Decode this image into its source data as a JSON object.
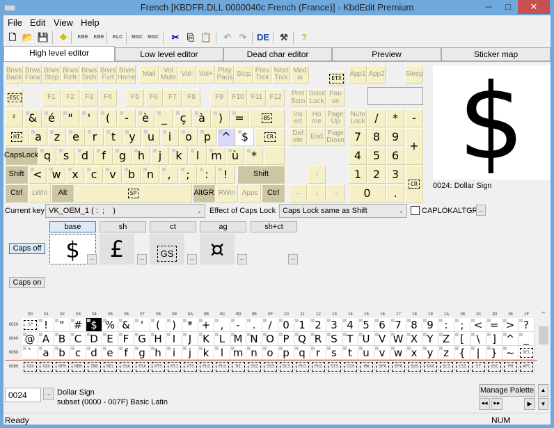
{
  "window": {
    "title": "French [KBDFR.DLL 0000040c French (France)] - KbdEdit Premium",
    "minimize": "─",
    "maximize": "□",
    "close": "✕"
  },
  "menu": [
    {
      "label": "File"
    },
    {
      "label": "Edit"
    },
    {
      "label": "View"
    },
    {
      "label": "Help"
    }
  ],
  "toolbar": [
    {
      "icon": "new-file-icon",
      "glyph": "🗋"
    },
    {
      "icon": "open-folder-icon",
      "glyph": "📂"
    },
    {
      "icon": "save-icon",
      "glyph": "💾"
    },
    {
      "icon": "package-icon",
      "glyph": "❖"
    },
    {
      "icon": "kbe-open-icon",
      "glyph": "KBE"
    },
    {
      "icon": "kbe-save-icon",
      "glyph": "KBE"
    },
    {
      "icon": "klc-open-icon",
      "glyph": "KLC"
    },
    {
      "icon": "mac-open-icon",
      "glyph": "MAC"
    },
    {
      "icon": "mac-save-icon",
      "glyph": "MAC"
    },
    {
      "icon": "cut-icon",
      "glyph": "✂"
    },
    {
      "icon": "copy-icon",
      "glyph": "⎘"
    },
    {
      "icon": "paste-icon",
      "glyph": "📋"
    },
    {
      "icon": "undo-icon",
      "glyph": "↶"
    },
    {
      "icon": "redo-icon",
      "glyph": "↷"
    },
    {
      "icon": "language-icon",
      "glyph": "DE"
    },
    {
      "icon": "tools-icon",
      "glyph": "⚒"
    },
    {
      "icon": "help-icon",
      "glyph": "?"
    }
  ],
  "tabs": [
    {
      "label": "High level editor",
      "active": true
    },
    {
      "label": "Low level editor"
    },
    {
      "label": "Dead char editor"
    },
    {
      "label": "Preview"
    },
    {
      "label": "Sticker map"
    }
  ],
  "keyboard": {
    "keys": [
      {
        "label": "Brws\nBack",
        "s": "dis"
      },
      {
        "label": "Brws\nForw",
        "s": "dis"
      },
      {
        "label": "Brws\nStop",
        "s": "dis"
      },
      {
        "label": "Brws\nRefr",
        "s": "dis"
      },
      {
        "label": "Brws\nSrch",
        "s": "dis"
      },
      {
        "label": "Brws\nFvrt",
        "s": "dis"
      },
      {
        "label": "Brws\nHome",
        "s": "dis"
      },
      {
        "label": "Mail",
        "s": "dis"
      },
      {
        "label": "Vol\nMute",
        "s": "dis"
      },
      {
        "label": "Vol-",
        "s": "dis"
      },
      {
        "label": "Vol+",
        "s": "dis"
      },
      {
        "label": "Play\nPaus",
        "s": "dis"
      },
      {
        "label": "Stop",
        "s": "dis"
      },
      {
        "label": "Prev\nTrck",
        "s": "dis"
      },
      {
        "label": "Next\nTrck",
        "s": "dis"
      },
      {
        "label": "Med\nia",
        "s": "dis"
      },
      {
        "label": "ETX",
        "s": "ctl"
      },
      {
        "label": "App1",
        "s": "dis"
      },
      {
        "label": "App2",
        "s": "dis"
      },
      {
        "label": "Sleep",
        "s": "dis"
      },
      {
        "label": "ESC",
        "s": "ctl"
      },
      {
        "label": "F1",
        "s": "dis"
      },
      {
        "label": "F2",
        "s": "dis"
      },
      {
        "label": "F3",
        "s": "dis"
      },
      {
        "label": "F4",
        "s": "dis"
      },
      {
        "label": "F5",
        "s": "dis"
      },
      {
        "label": "F6",
        "s": "dis"
      },
      {
        "label": "F7",
        "s": "dis"
      },
      {
        "label": "F8",
        "s": "dis"
      },
      {
        "label": "F9",
        "s": "dis"
      },
      {
        "label": "F10",
        "s": "dis"
      },
      {
        "label": "F11",
        "s": "dis"
      },
      {
        "label": "F12",
        "s": "dis"
      },
      {
        "label": "Prnt\nScrn",
        "s": "dis"
      },
      {
        "label": "Scrol\nLock",
        "s": "dis"
      },
      {
        "label": "Pau\nse",
        "s": "dis"
      },
      {
        "label": "²",
        "s": "small"
      },
      {
        "label": "&"
      },
      {
        "label": "é"
      },
      {
        "label": "\""
      },
      {
        "label": "'"
      },
      {
        "label": "("
      },
      {
        "label": "-"
      },
      {
        "label": "è"
      },
      {
        "label": "_"
      },
      {
        "label": "ç"
      },
      {
        "label": "à"
      },
      {
        "label": ")"
      },
      {
        "label": "="
      },
      {
        "label": "BS",
        "s": "ctl"
      },
      {
        "label": "Ins\nert",
        "s": "dis"
      },
      {
        "label": "Ho\nme",
        "s": "dis"
      },
      {
        "label": "Page\nUp",
        "s": "dis"
      },
      {
        "label": "Num\nLock",
        "s": "dis"
      },
      {
        "label": "/"
      },
      {
        "label": "*"
      },
      {
        "label": "-"
      },
      {
        "label": "HT",
        "s": "ctl"
      },
      {
        "label": "a"
      },
      {
        "label": "z"
      },
      {
        "label": "e"
      },
      {
        "label": "r"
      },
      {
        "label": "t"
      },
      {
        "label": "y"
      },
      {
        "label": "u"
      },
      {
        "label": "i"
      },
      {
        "label": "o"
      },
      {
        "label": "p"
      },
      {
        "label": "^",
        "s": "hl"
      },
      {
        "label": "$",
        "s": "sel"
      },
      {
        "label": "CR",
        "s": "ctl"
      },
      {
        "label": "Del\nete",
        "s": "dis"
      },
      {
        "label": "End",
        "s": "dis"
      },
      {
        "label": "Page\nDown",
        "s": "dis"
      },
      {
        "label": "7"
      },
      {
        "label": "8"
      },
      {
        "label": "9"
      },
      {
        "label": "+"
      },
      {
        "label": "CapsLock",
        "s": "mod"
      },
      {
        "label": "q"
      },
      {
        "label": "s"
      },
      {
        "label": "d"
      },
      {
        "label": "f"
      },
      {
        "label": "g"
      },
      {
        "label": "h"
      },
      {
        "label": "j"
      },
      {
        "label": "k"
      },
      {
        "label": "l"
      },
      {
        "label": "m"
      },
      {
        "label": "ù"
      },
      {
        "label": "*"
      },
      {
        "label": ""
      },
      {
        "label": "4"
      },
      {
        "label": "5"
      },
      {
        "label": "6"
      },
      {
        "label": "Shift",
        "s": "mod"
      },
      {
        "label": "<"
      },
      {
        "label": "w"
      },
      {
        "label": "x"
      },
      {
        "label": "c"
      },
      {
        "label": "v"
      },
      {
        "label": "b"
      },
      {
        "label": "n"
      },
      {
        "label": ","
      },
      {
        "label": ";"
      },
      {
        "label": ":"
      },
      {
        "label": "!"
      },
      {
        "label": "Shift",
        "s": "mod"
      },
      {
        "label": "↑",
        "s": "dis"
      },
      {
        "label": "1"
      },
      {
        "label": "2"
      },
      {
        "label": "3"
      },
      {
        "label": "CR",
        "s": "ctl"
      },
      {
        "label": "Ctrl",
        "s": "mod"
      },
      {
        "label": "LWin",
        "s": "dis"
      },
      {
        "label": "Alt",
        "s": "mod"
      },
      {
        "label": "SP",
        "s": "ctl"
      },
      {
        "label": "AltGR",
        "s": "mod"
      },
      {
        "label": "RWin",
        "s": "dis"
      },
      {
        "label": "Apps",
        "s": "dis"
      },
      {
        "label": "Ctrl",
        "s": "mod"
      },
      {
        "label": "←",
        "s": "dis"
      },
      {
        "label": "↓",
        "s": "dis"
      },
      {
        "label": "→",
        "s": "dis"
      },
      {
        "label": "0"
      },
      {
        "label": "."
      }
    ]
  },
  "preview": {
    "char": "$",
    "caption": "0024: Dollar Sign"
  },
  "current_key": {
    "label": "Current key",
    "value": "VK_OEM_1 ( :  ;    )"
  },
  "caps_effect": {
    "label": "Effect of Caps Lock",
    "value": "Caps Lock same as Shift"
  },
  "caplokaltgr": {
    "label": "CAPLOKALTGR",
    "checked": false,
    "more": "..."
  },
  "shift_states": [
    {
      "label": "base",
      "char": "$",
      "active": true
    },
    {
      "label": "sh",
      "char": "£"
    },
    {
      "label": "ct",
      "char": "GS",
      "control": true
    },
    {
      "label": "ag",
      "char": "¤"
    },
    {
      "label": "sh+ct",
      "char": ""
    }
  ],
  "more_label": "...",
  "caps_off": "Caps off",
  "caps_on": "Caps on",
  "grid": {
    "columns": [
      "00",
      "01",
      "02",
      "03",
      "04",
      "05",
      "06",
      "07",
      "08",
      "09",
      "0A",
      "0B",
      "0C",
      "0D",
      "0E",
      "0F",
      "10",
      "11",
      "12",
      "13",
      "14",
      "15",
      "16",
      "17",
      "18",
      "19",
      "1A",
      "1B",
      "1C",
      "1D",
      "1E",
      "1F"
    ],
    "rows": [
      {
        "code": "0020",
        "cells": [
          "SP",
          "!",
          "\"",
          "#",
          "$",
          "%",
          "&",
          "'",
          "(",
          ")",
          "*",
          "+",
          ",",
          "-",
          ".",
          "/",
          "0",
          "1",
          "2",
          "3",
          "4",
          "5",
          "6",
          "7",
          "8",
          "9",
          ":",
          ";",
          "<",
          "=",
          ">",
          "?"
        ]
      },
      {
        "code": "0040",
        "cells": [
          "@",
          "A",
          "B",
          "C",
          "D",
          "E",
          "F",
          "G",
          "H",
          "I",
          "J",
          "K",
          "L",
          "M",
          "N",
          "O",
          "P",
          "Q",
          "R",
          "S",
          "T",
          "U",
          "V",
          "W",
          "X",
          "Y",
          "Z",
          "[",
          "\\",
          "]",
          "^",
          "_"
        ]
      },
      {
        "code": "0060",
        "cells": [
          "`",
          "a",
          "b",
          "c",
          "d",
          "e",
          "f",
          "g",
          "h",
          "i",
          "j",
          "k",
          "l",
          "m",
          "n",
          "o",
          "p",
          "q",
          "r",
          "s",
          "t",
          "u",
          "v",
          "w",
          "x",
          "y",
          "z",
          "{",
          "|",
          "}",
          "~",
          "DEL"
        ]
      },
      {
        "code": "0080",
        "cells": [
          "XXX",
          "XXX",
          "BPH",
          "NBH",
          "IND",
          "NEL",
          "SSA",
          "ESA",
          "HTS",
          "HTJ",
          "VTS",
          "PLD",
          "PLU",
          "RI",
          "SS2",
          "SS3",
          "DCS",
          "PU1",
          "PU2",
          "STS",
          "CCH",
          "MW",
          "SPA",
          "EPA",
          "SOS",
          "XXX",
          "SCI",
          "CSI",
          "ST",
          "OSC",
          "PM",
          "APC"
        ]
      }
    ],
    "selected": "$"
  },
  "bottom": {
    "code": "0024",
    "more": "...",
    "name": "Dollar Sign",
    "subset": "subset (0000 - 007F) Basic Latin",
    "manage_palette": "Manage Palette",
    "up": "▲",
    "down": "▼",
    "prev": "◀◀",
    "next": "▶▶",
    "play": "▶"
  },
  "status": {
    "text": "Ready",
    "num": "NUM"
  }
}
